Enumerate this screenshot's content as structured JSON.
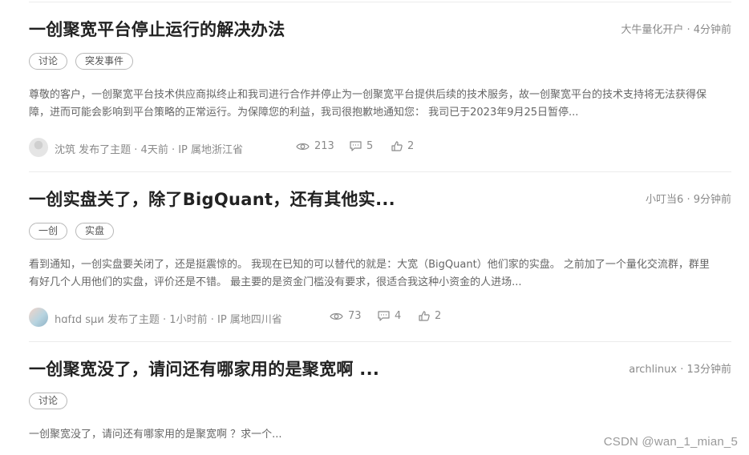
{
  "posts": [
    {
      "title": "一创聚宽平台停止运行的解决办法",
      "meta_right": "大牛量化开户 · 4分钟前",
      "tags": [
        "讨论",
        "突发事件"
      ],
      "excerpt": "尊敬的客户，一创聚宽平台技术供应商拟终止和我司进行合作并停止为一创聚宽平台提供后续的技术服务，故一创聚宽平台的技术支持将无法获得保障，进而可能会影响到平台策略的正常运行。为保障您的利益，我司很抱歉地通知您： 我司已于2023年9月25日暂停...",
      "author": "沈筑",
      "author_suffix": " 发布了主题 · 4天前 · IP 属地浙江省",
      "views": "213",
      "comments": "5",
      "likes": "2"
    },
    {
      "title": "一创实盘关了，除了BigQuant，还有其他实...",
      "meta_right": "小叮当6 · 9分钟前",
      "tags": [
        "一创",
        "实盘"
      ],
      "excerpt": "看到通知，一创实盘要关闭了，还是挺震惊的。 我现在已知的可以替代的就是：大宽（BigQuant）他们家的实盘。 之前加了一个量化交流群，群里有好几个人用他们的实盘，评价还是不错。 最主要的是资金门槛没有要求，很适合我这种小资金的人进场...",
      "author": "hɑfɪd sμи",
      "author_suffix": " 发布了主题 · 1小时前 · IP 属地四川省",
      "views": "73",
      "comments": "4",
      "likes": "2"
    },
    {
      "title": "一创聚宽没了，请问还有哪家用的是聚宽啊 ...",
      "meta_right": "archlinux · 13分钟前",
      "tags": [
        "讨论"
      ],
      "excerpt": "一创聚宽没了，请问还有哪家用的是聚宽啊 ？求一个..."
    }
  ],
  "watermark": "CSDN @wan_1_mian_5",
  "icons": {
    "views": "eye-icon",
    "comments": "comment-icon",
    "likes": "thumbs-up-icon"
  }
}
